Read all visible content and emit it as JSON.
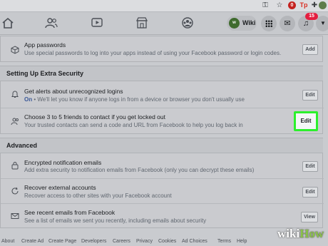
{
  "browser": {
    "extensions": [
      "key-icon",
      "star-icon",
      "stop-icon",
      "tp-icon",
      "puzzle-icon",
      "profile-icon"
    ],
    "stop_label": "0",
    "tp_label": "Tp"
  },
  "nav": {
    "profile_name": "Wiki",
    "profile_initials": "w",
    "notification_count": "15"
  },
  "top_row": {
    "title": "App passwords",
    "desc": "Use special passwords to log into your apps instead of using your Facebook password or login codes.",
    "button": "Add"
  },
  "extra_security": {
    "heading": "Setting Up Extra Security",
    "rows": [
      {
        "title": "Get alerts about unrecognized logins",
        "desc_prefix": "On",
        "desc": " • We'll let you know if anyone logs in from a device or browser you don't usually use",
        "button": "Edit"
      },
      {
        "title": "Choose 3 to 5 friends to contact if you get locked out",
        "desc": "Your trusted contacts can send a code and URL from Facebook to help you log back in",
        "button": "Edit"
      }
    ]
  },
  "advanced": {
    "heading": "Advanced",
    "rows": [
      {
        "title": "Encrypted notification emails",
        "desc": "Add extra security to notification emails from Facebook (only you can decrypt these emails)",
        "button": "Edit"
      },
      {
        "title": "Recover external accounts",
        "desc": "Recover access to other sites with your Facebook account",
        "button": "Edit"
      },
      {
        "title": "See recent emails from Facebook",
        "desc": "See a list of emails we sent you recently, including emails about security",
        "button": "View"
      }
    ]
  },
  "footer": {
    "links": [
      "About",
      "Create Ad",
      "Create Page",
      "Developers",
      "Careers",
      "Privacy",
      "Cookies",
      "Ad Choices",
      "Terms",
      "Help"
    ]
  },
  "watermark": {
    "wiki": "wiki",
    "how": "How"
  },
  "colors": {
    "highlight": "#2cf02c",
    "accent": "#3b5998",
    "badge": "#e41e3f"
  }
}
